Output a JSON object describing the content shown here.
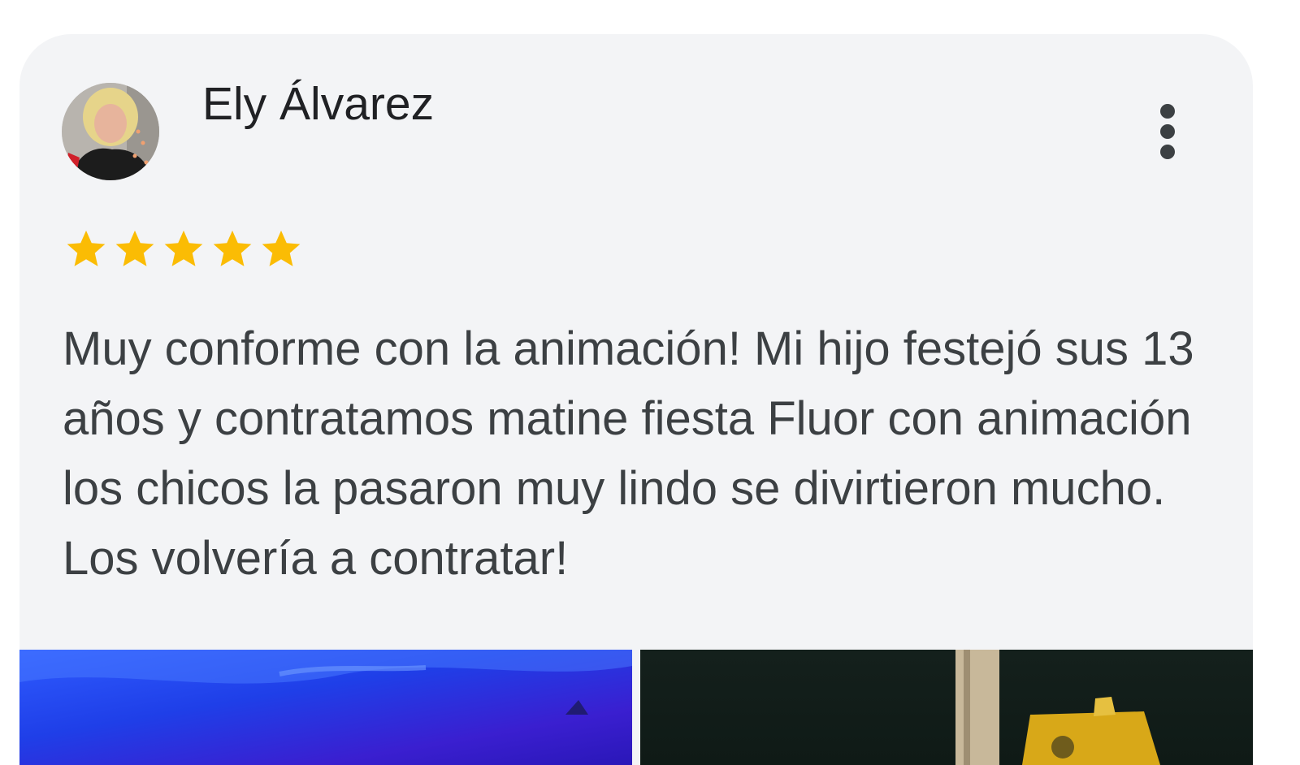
{
  "review": {
    "author": "Ely Álvarez",
    "rating": 5,
    "rating_max": 5,
    "text": "Muy conforme con la animación! Mi hijo festejó sus 13 años y contratamos matine fiesta Fluor con animación los chicos la pasaron muy lindo se divirtieron mucho. Los volvería a contratar!"
  },
  "icons": {
    "more": "more-vert-icon",
    "star": "star-icon"
  },
  "colors": {
    "card_background": "#f3f4f6",
    "star": "#fbbc04",
    "text": "#3c4043",
    "author": "#202124"
  }
}
